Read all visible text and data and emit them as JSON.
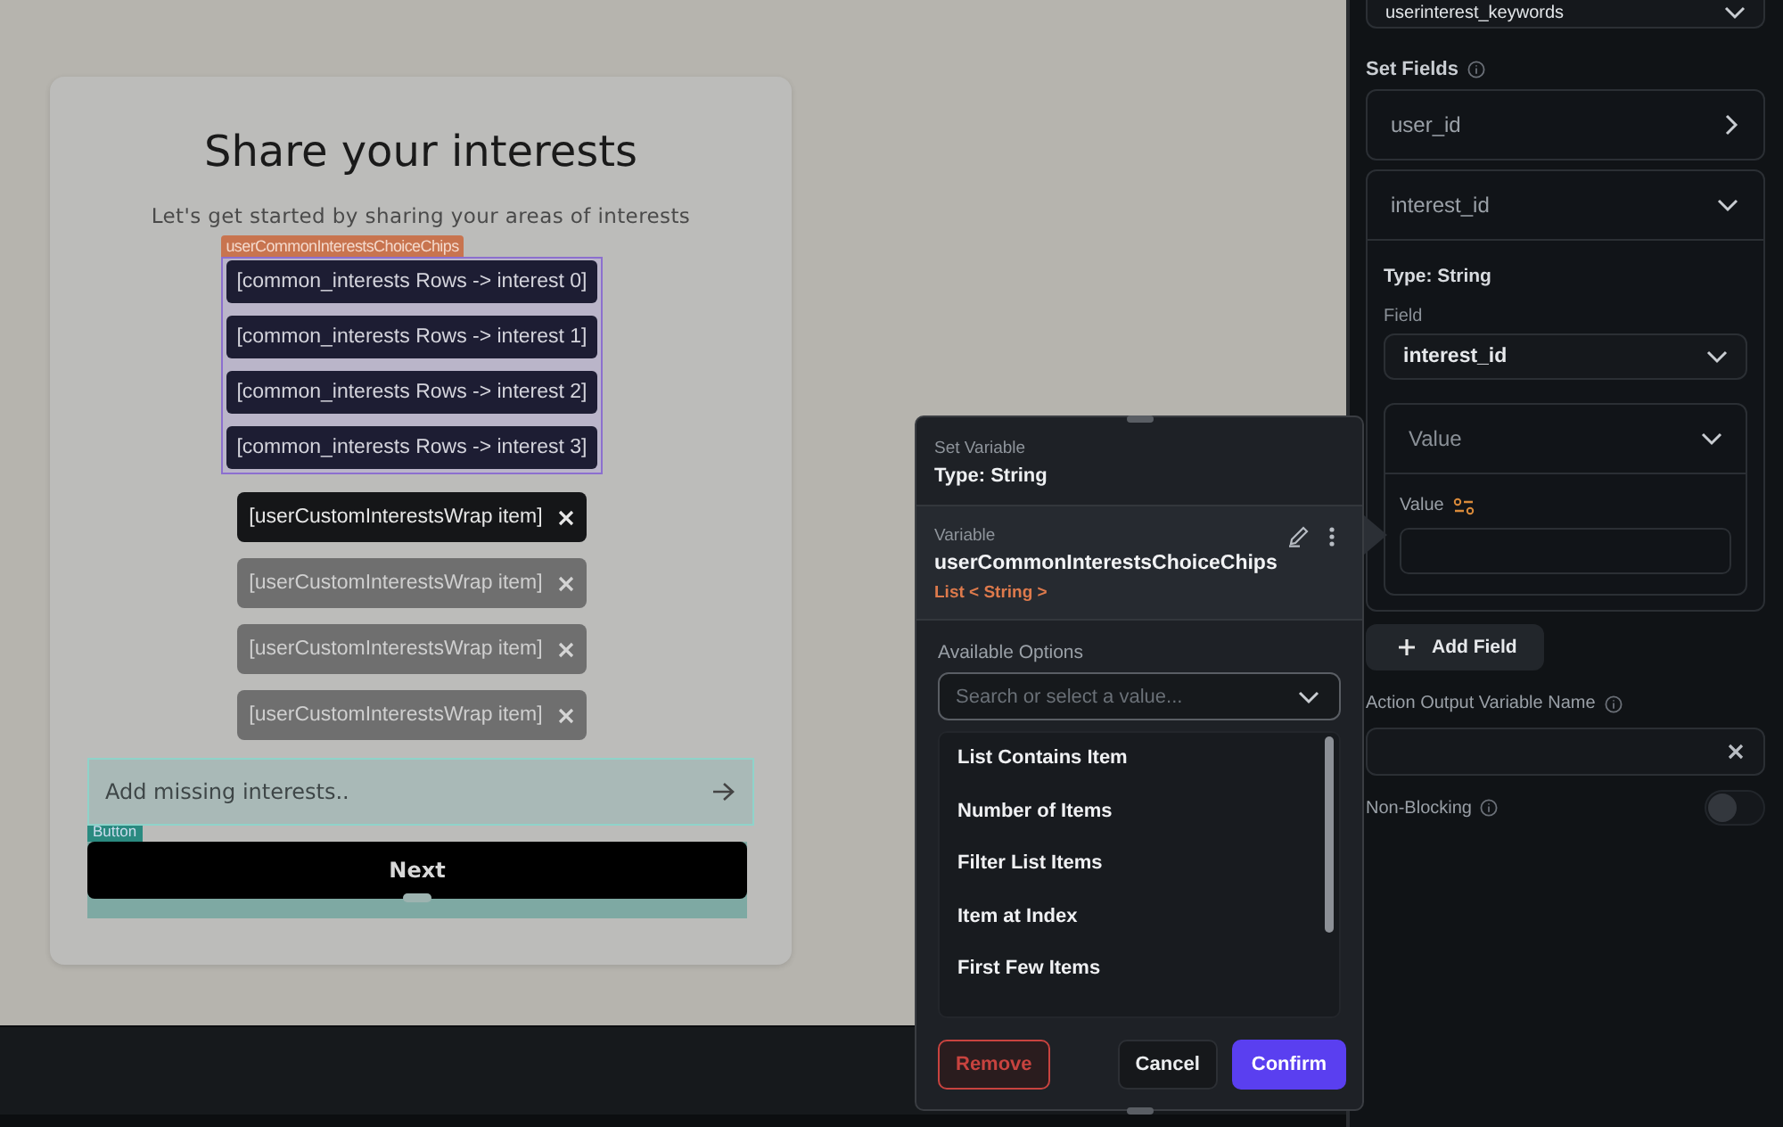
{
  "canvas": {
    "title": "Share your interests",
    "subtitle": "Let's get started by sharing your areas of interests",
    "choice_chips": {
      "tag": "userCommonInterestsChoiceChips",
      "chips": [
        "[common_interests Rows -> interest 0]",
        "[common_interests Rows -> interest 1]",
        "[common_interests Rows -> interest 2]",
        "[common_interests Rows -> interest 3]"
      ]
    },
    "custom_chips": [
      {
        "label": "[userCustomInterestsWrap item]",
        "selected": true
      },
      {
        "label": "[userCustomInterestsWrap item]",
        "selected": false
      },
      {
        "label": "[userCustomInterestsWrap item]",
        "selected": false
      },
      {
        "label": "[userCustomInterestsWrap item]",
        "selected": false
      }
    ],
    "input": {
      "placeholder": "Add missing interests.."
    },
    "button_tag": "Button",
    "next_button": "Next"
  },
  "popup": {
    "header_label": "Set Variable",
    "type": "Type: String",
    "variable_label": "Variable",
    "variable": "userCommonInterestsChoiceChips",
    "variable_type": "List < String >",
    "options_label": "Available Options",
    "search": {
      "placeholder": "Search or select a value..."
    },
    "options": [
      "List Contains Item",
      "Number of Items",
      "Filter List Items",
      "Item at Index",
      "First Few Items"
    ],
    "buttons": [
      {
        "label": "Remove",
        "kind": "danger"
      },
      {
        "label": "Cancel",
        "kind": "secondary"
      },
      {
        "label": "Confirm",
        "kind": "primary"
      }
    ]
  },
  "panel": {
    "collection": "userinterest_keywords",
    "set_fields_label": "Set Fields",
    "fields": [
      {
        "name": "user_id",
        "expanded": false
      },
      {
        "name": "interest_id",
        "expanded": true,
        "type": "Type: String",
        "field_label": "Field",
        "field_value": "interest_id",
        "value_section": {
          "title": "Value",
          "expanded": true,
          "value_label": "Value"
        }
      }
    ],
    "add_field": "Add Field",
    "output_label": "Action Output Variable Name",
    "non_blocking": {
      "label": "Non-Blocking",
      "on": false
    }
  }
}
